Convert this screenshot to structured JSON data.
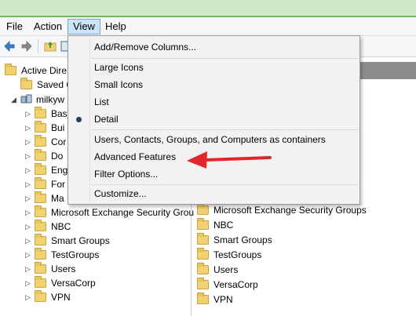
{
  "menubar": {
    "items": [
      {
        "label": "File"
      },
      {
        "label": "Action"
      },
      {
        "label": "View"
      },
      {
        "label": "Help"
      }
    ]
  },
  "view_menu": {
    "add_remove_columns": "Add/Remove Columns...",
    "large_icons": "Large Icons",
    "small_icons": "Small Icons",
    "list": "List",
    "detail": "Detail",
    "users_contacts_containers": "Users, Contacts, Groups, and Computers as containers",
    "advanced_features": "Advanced Features",
    "filter_options": "Filter Options...",
    "customize": "Customize...",
    "selected_view": "Detail"
  },
  "tree": {
    "root": "Active Dire",
    "saved_queries": "Saved Q",
    "domain": "milkyw",
    "children": [
      "Bas",
      "Bui",
      "Cor",
      "Do",
      "Eng",
      "For",
      "Ma",
      "Microsoft Exchange Security Grou",
      "NBC",
      "Smart Groups",
      "TestGroups",
      "Users",
      "VersaCorp",
      "VPN"
    ]
  },
  "list": {
    "items": [
      "Microsoft Exchange Security Groups",
      "NBC",
      "Smart Groups",
      "TestGroups",
      "Users",
      "VersaCorp",
      "VPN"
    ]
  },
  "colors": {
    "annotation_arrow": "#e0262b",
    "menu_highlight": "#cce4f7",
    "folder": "#f2d173"
  },
  "icons": [
    "back-arrow-icon",
    "forward-arrow-icon",
    "up-folder-icon",
    "console-tree-icon",
    "folder-icon",
    "domain-icon",
    "radio-dot-icon"
  ]
}
